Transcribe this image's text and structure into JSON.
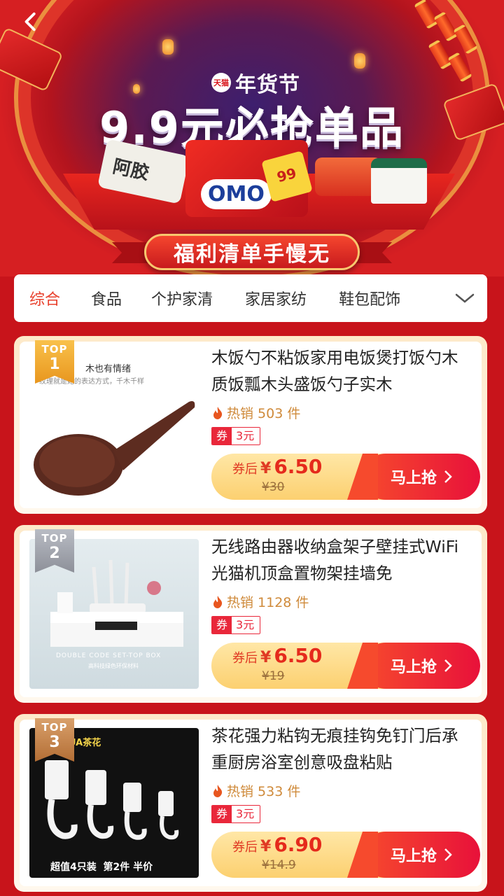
{
  "banner": {
    "brand_logo": "天猫",
    "brand_tag": "年货节",
    "title": "9.9元必抢单品",
    "ribbon": "福利清单手慢无",
    "prod_label_left": "阿胶",
    "prod_label_omo": "OMO",
    "prod_label_99": "99"
  },
  "tabs": [
    {
      "label": "综合",
      "active": true
    },
    {
      "label": "食品"
    },
    {
      "label": "个护家清"
    },
    {
      "label": "家居家纺"
    },
    {
      "label": "鞋包配饰"
    }
  ],
  "products": [
    {
      "rank_top": "TOP",
      "rank": "1",
      "title": "木饭勺不粘饭家用电饭煲打饭勺木质饭瓢木头盛饭勺子实木",
      "sales": "热销 503 件",
      "coupon_tag": "券",
      "coupon_value": "3元",
      "price_label": "券后",
      "currency": "¥",
      "price": "6.50",
      "original_price": "¥30",
      "button": "马上抢",
      "img_text_1": "木也有情绪",
      "img_text_2": "纹理就是她的表达方式，千木千样"
    },
    {
      "rank_top": "TOP",
      "rank": "2",
      "title": "无线路由器收纳盒架子壁挂式WiFi光猫机顶盒置物架挂墙免",
      "sales": "热销 1128 件",
      "coupon_tag": "券",
      "coupon_value": "3元",
      "price_label": "券后",
      "currency": "¥",
      "price": "6.50",
      "original_price": "¥19",
      "button": "马上抢",
      "img_text_1": "DOUBLE CODE SET-TOP BOX",
      "img_text_2": "高科技绿色环保材料"
    },
    {
      "rank_top": "TOP",
      "rank": "3",
      "title": "茶花强力粘钩无痕挂钩免钉门后承重厨房浴室创意吸盘粘贴",
      "sales": "热销 533 件",
      "coupon_tag": "券",
      "coupon_value": "3元",
      "price_label": "券后",
      "currency": "¥",
      "price": "6.90",
      "original_price": "¥14.9",
      "button": "马上抢",
      "img_text_1": "UA茶花",
      "img_text_2": "超值4只装  第2件 半价"
    }
  ],
  "icons": {
    "back": "back-arrow-icon",
    "more": "chevron-down-icon",
    "sales": "flame-icon",
    "button": "chevron-right-icon"
  },
  "colors": {
    "primary_red": "#c8141b",
    "tab_active": "#e8402c",
    "price": "#e52a1c",
    "sales": "#cf8a3a",
    "coupon": "#e9273a"
  }
}
